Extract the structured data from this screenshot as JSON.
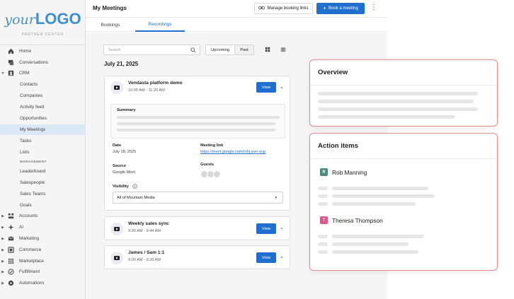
{
  "brand": {
    "logo_your": "your",
    "logo_big": "LOGO",
    "partner_center": "PARTNER CENTER"
  },
  "sidebar": {
    "items": [
      {
        "label": "Home",
        "icon": "home-icon"
      },
      {
        "label": "Conversations",
        "icon": "chat-icon"
      },
      {
        "label": "CRM",
        "icon": "contacts-icon",
        "expanded": true
      },
      {
        "label": "Contacts"
      },
      {
        "label": "Companies"
      },
      {
        "label": "Activity feed"
      },
      {
        "label": "Opportunities"
      },
      {
        "label": "My Meetings",
        "active": true
      },
      {
        "label": "Tasks"
      },
      {
        "label": "Lists"
      },
      {
        "label": "Leaderboard"
      },
      {
        "label": "Salespeople"
      },
      {
        "label": "Sales Teams"
      },
      {
        "label": "Goals"
      },
      {
        "label": "Accounts",
        "icon": "accounts-icon"
      },
      {
        "label": "AI",
        "icon": "sparkle-icon"
      },
      {
        "label": "Marketing",
        "icon": "mail-icon"
      },
      {
        "label": "Commerce",
        "icon": "commerce-icon"
      },
      {
        "label": "Marketplace",
        "icon": "grid-icon"
      },
      {
        "label": "Fulfillment",
        "icon": "check-circle-icon"
      },
      {
        "label": "Automations",
        "icon": "automation-icon"
      }
    ],
    "section_management": "MANAGEMENT"
  },
  "header": {
    "title": "My Meetings",
    "manage_links_label": "Manage booking links",
    "book_meeting_label": "Book a meeting"
  },
  "tabs": [
    {
      "label": "Bookings"
    },
    {
      "label": "Recordings",
      "active": true
    }
  ],
  "toolbar": {
    "search_placeholder": "Search",
    "upcoming_label": "Upcoming",
    "past_label": "Past"
  },
  "date_heading": "July 21, 2025",
  "recordings": [
    {
      "title": "Vendasta platform demo",
      "time": "10:05 AM - 11:20 AM",
      "view_label": "View",
      "expanded": true,
      "summary_label": "Summary",
      "date_label": "Date",
      "date_value": "July 18, 2025",
      "meeting_link_label": "Meeting link",
      "meeting_link_value": "https://meet.google.com/mhj-pvn-ecp",
      "source_label": "Source",
      "source_value": "Google Meet",
      "guests_label": "Guests",
      "visibility_label": "Visibility",
      "visibility_value": "All of Mountain Media"
    },
    {
      "title": "Weekly sales sync",
      "time": "9:30 AM - 9:44 AM",
      "view_label": "View"
    },
    {
      "title": "James / Sam 1:1",
      "time": "9:00 AM - 9:26 AM",
      "view_label": "View"
    }
  ],
  "overview_panel": {
    "title": "Overview"
  },
  "action_items_panel": {
    "title": "Action items",
    "people": [
      {
        "initial": "R",
        "name": "Rob Manning",
        "color": "#4a8a78"
      },
      {
        "initial": "T",
        "name": "Theresa Thompson",
        "color": "#d6588c"
      }
    ]
  },
  "colors": {
    "accent": "#1e6fd0",
    "panel_border": "#e98a8a",
    "active_nav": "#dbe9f7"
  }
}
